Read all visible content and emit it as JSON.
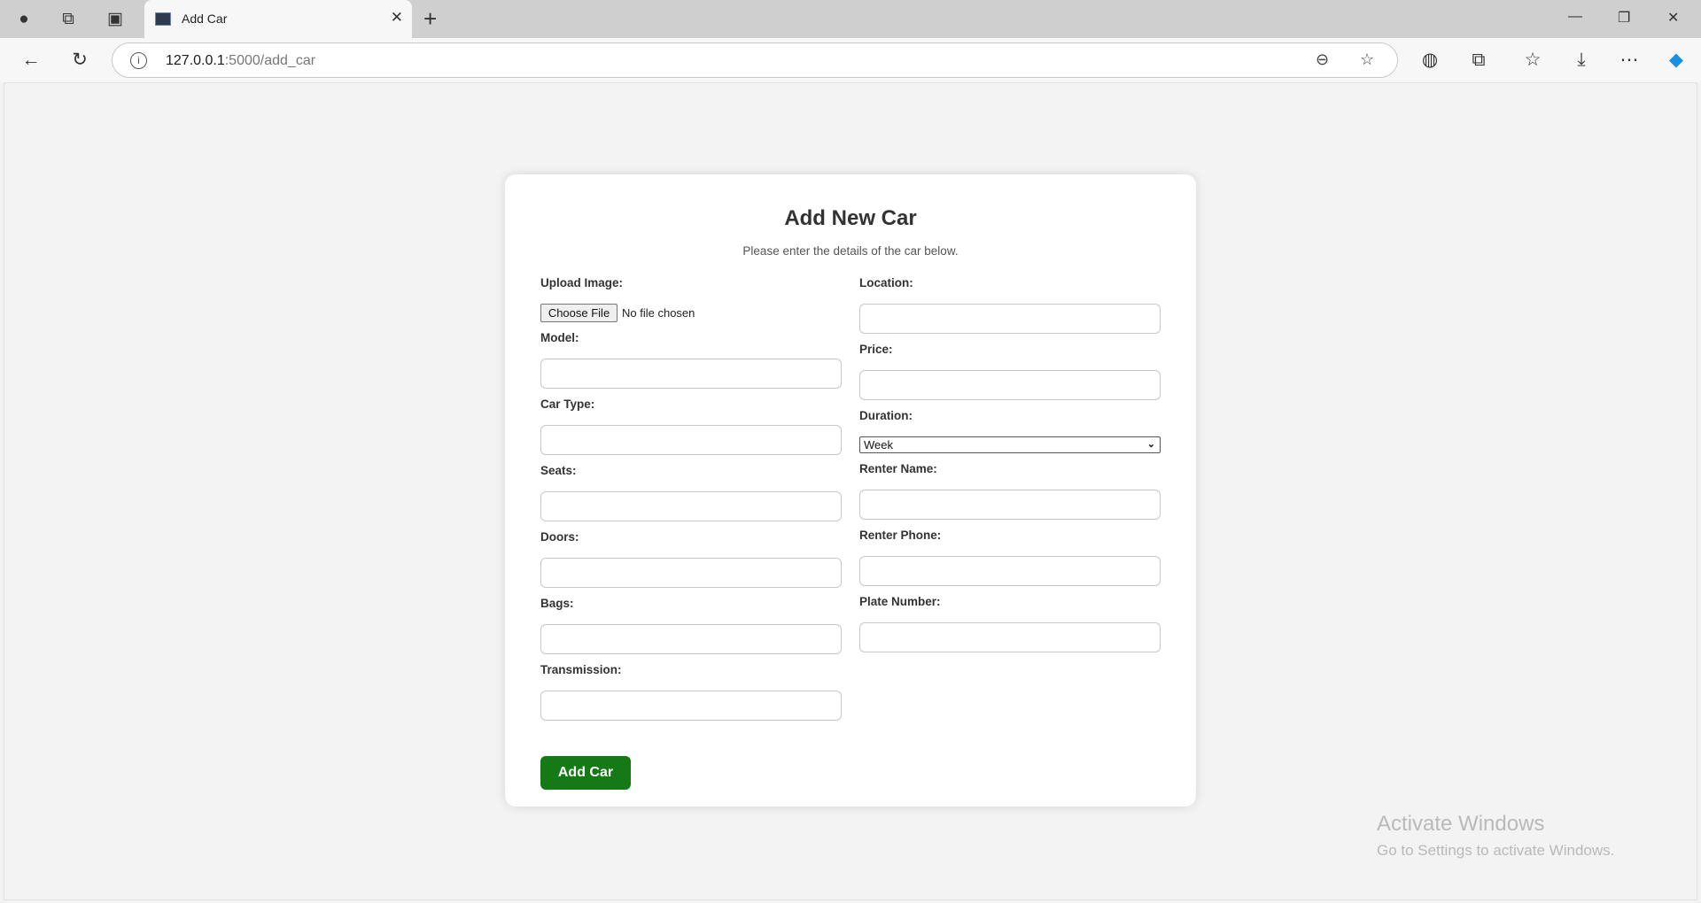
{
  "browser": {
    "tab_title": "Add Car",
    "url_host": "127.0.0.1",
    "url_rest": ":5000/add_car"
  },
  "form": {
    "title": "Add New Car",
    "subtitle": "Please enter the details of the car below.",
    "upload_label": "Upload Image:",
    "choose_file": "Choose File",
    "no_file": "No file chosen",
    "model_label": "Model:",
    "car_type_label": "Car Type:",
    "seats_label": "Seats:",
    "doors_label": "Doors:",
    "bags_label": "Bags:",
    "transmission_label": "Transmission:",
    "location_label": "Location:",
    "price_label": "Price:",
    "duration_label": "Duration:",
    "duration_value": "Week",
    "renter_name_label": "Renter Name:",
    "renter_phone_label": "Renter Phone:",
    "plate_label": "Plate Number:",
    "submit": "Add Car",
    "accent": "#157a15"
  },
  "watermark": {
    "line1": "Activate Windows",
    "line2": "Go to Settings to activate Windows."
  }
}
